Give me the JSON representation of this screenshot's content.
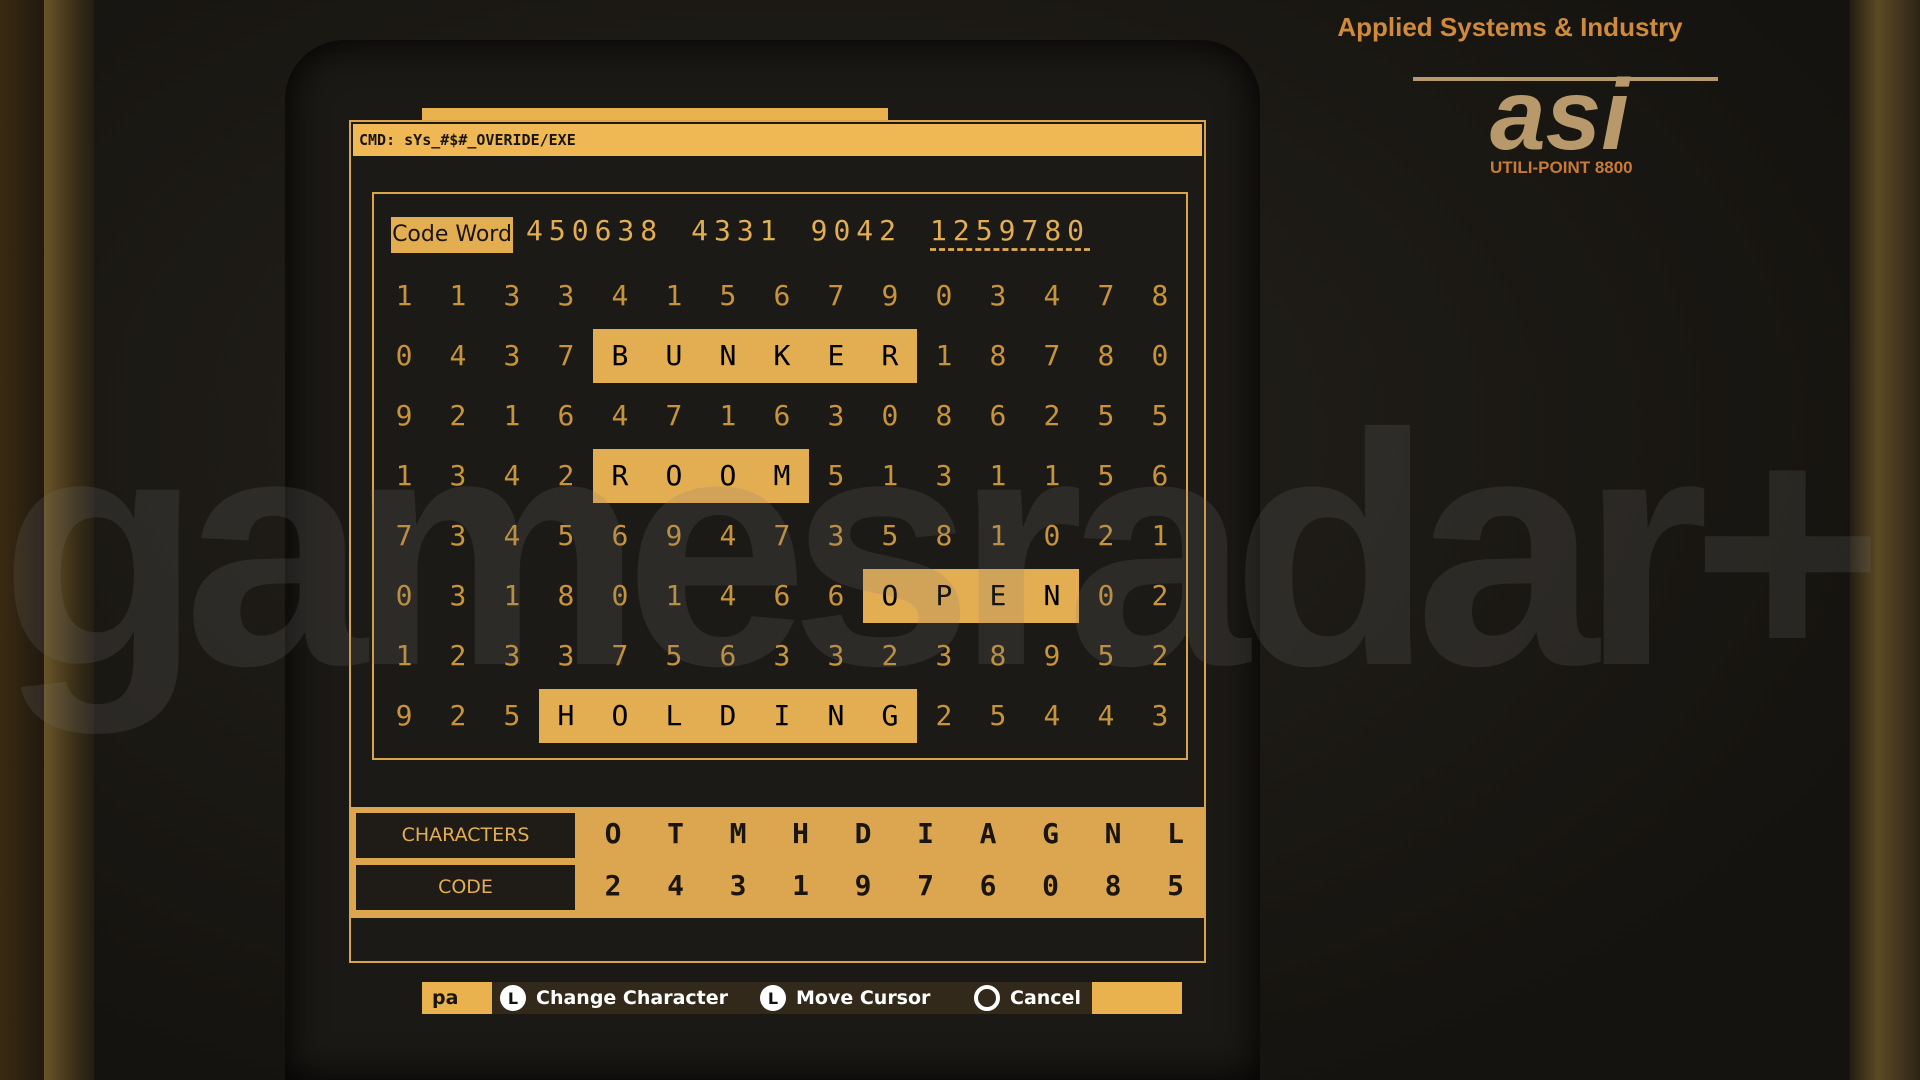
{
  "brand": {
    "company": "Applied Systems & Industry",
    "logo": "asi",
    "model": "UTILI-POINT 8800"
  },
  "watermark": "gamesradar+",
  "cmd": "CMD: sYs_#$#_OVERIDE/EXE",
  "code_word": {
    "label": "Code Word",
    "groups": [
      "450638",
      "4331",
      "9042",
      "1259780"
    ]
  },
  "grid": {
    "rows": [
      "113341567903478",
      "0437BUNKER18780",
      "921647163086255",
      "1342ROOM5131156",
      "734569473581021",
      "031801466OPEN02",
      "123375633238952",
      "925HOLDING25443"
    ],
    "highlight_color": "#e3ad52"
  },
  "legend": {
    "characters_label": "CHARACTERS",
    "code_label": "CODE",
    "characters": [
      "O",
      "T",
      "M",
      "H",
      "D",
      "I",
      "A",
      "G",
      "N",
      "L"
    ],
    "codes": [
      "2",
      "4",
      "3",
      "1",
      "9",
      "7",
      "6",
      "0",
      "8",
      "5"
    ]
  },
  "hints": {
    "left_tag": "pa",
    "change": "Change Character",
    "move": "Move Cursor",
    "cancel": "Cancel",
    "stick_glyph": "L",
    "cancel_icon": "circle-button-icon"
  }
}
